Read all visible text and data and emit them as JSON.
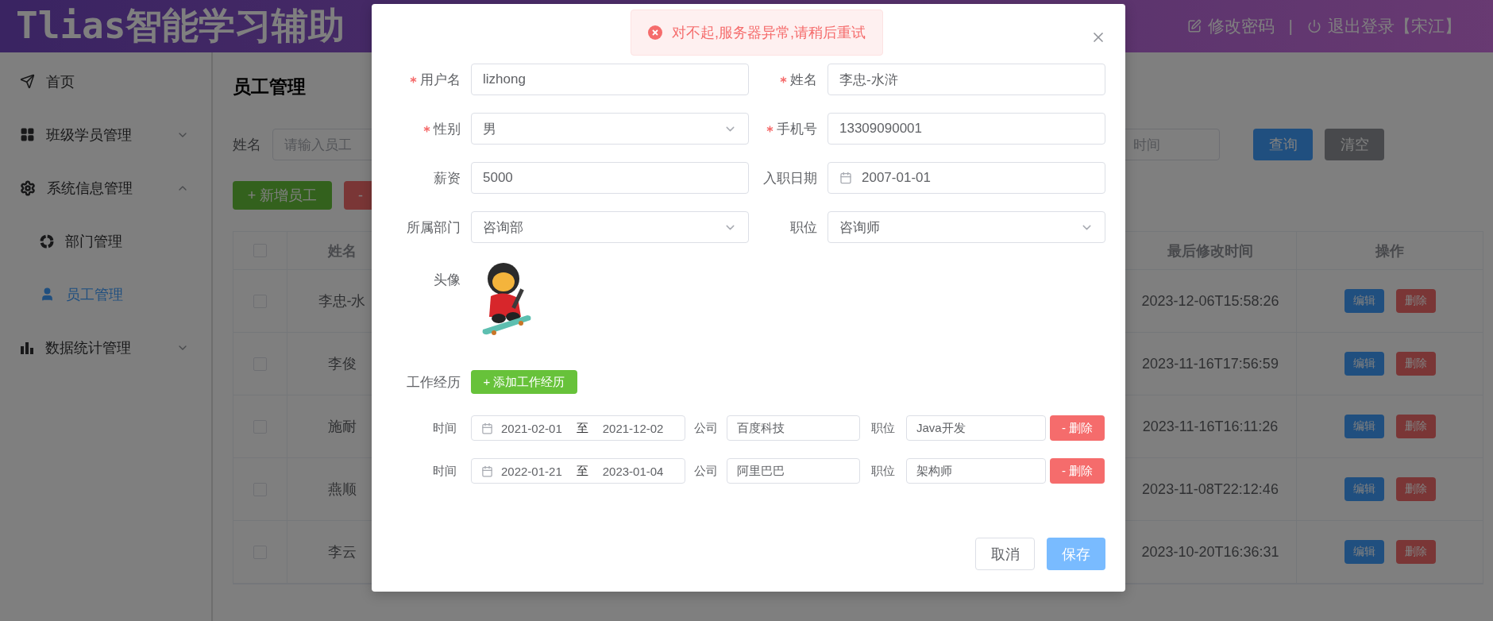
{
  "header": {
    "title": "Tlias智能学习辅助",
    "separator": "|",
    "actions": [
      {
        "label": "修改密码"
      },
      {
        "label": "退出登录【宋江】"
      }
    ]
  },
  "sidebar": {
    "items": [
      {
        "label": "首页",
        "selected": false
      },
      {
        "label": "班级学员管理",
        "selected": false,
        "expanded": false
      },
      {
        "label": "系统信息管理",
        "selected": false,
        "expanded": true,
        "children": [
          {
            "label": "部门管理",
            "selected": false
          },
          {
            "label": "员工管理",
            "selected": true
          }
        ]
      },
      {
        "label": "数据统计管理",
        "selected": false,
        "expanded": false
      }
    ]
  },
  "page": {
    "title": "员工管理",
    "search": {
      "name_label": "姓名",
      "name_placeholder": "请输入员工",
      "end_placeholder": "时间",
      "buttons": [
        {
          "label": "查询",
          "kind": "primary"
        },
        {
          "label": "清空",
          "kind": "info"
        }
      ]
    },
    "toolbar": [
      {
        "label": "+ 新增员工",
        "kind": "success"
      },
      {
        "label": "-",
        "kind": "danger"
      }
    ],
    "table": {
      "all_checked": false,
      "columns": [
        "姓名",
        "最后修改时间",
        "操作"
      ],
      "rows": [
        {
          "checked": false,
          "name": "李忠-水",
          "updated": "2023-12-06T15:58:26",
          "actions": [
            "编辑",
            "删除"
          ]
        },
        {
          "checked": false,
          "name": "李俊",
          "updated": "2023-11-16T17:56:59",
          "actions": [
            "编辑",
            "删除"
          ]
        },
        {
          "checked": false,
          "name": "施耐",
          "updated": "2023-11-16T16:11:26",
          "actions": [
            "编辑",
            "删除"
          ]
        },
        {
          "checked": false,
          "name": "燕顺",
          "updated": "2023-11-08T22:12:46",
          "actions": [
            "编辑",
            "删除"
          ]
        },
        {
          "checked": false,
          "name": "李云",
          "updated": "2023-10-20T16:36:31",
          "actions": [
            "编辑",
            "删除"
          ]
        }
      ]
    }
  },
  "dialog": {
    "message": {
      "kind": "error",
      "text": "对不起,服务器异常,请稍后重试"
    },
    "fields": [
      {
        "label": "用户名",
        "required": true,
        "kind": "text",
        "value": "lizhong"
      },
      {
        "label": "姓名",
        "required": true,
        "kind": "text",
        "value": "李忠-水浒"
      },
      {
        "label": "性别",
        "required": true,
        "kind": "select",
        "value": "男"
      },
      {
        "label": "手机号",
        "required": true,
        "kind": "text",
        "value": "13309090001"
      },
      {
        "label": "薪资",
        "required": false,
        "kind": "text",
        "value": "5000"
      },
      {
        "label": "入职日期",
        "required": false,
        "kind": "date",
        "value": "2007-01-01"
      },
      {
        "label": "所属部门",
        "required": false,
        "kind": "select",
        "value": "咨询部"
      },
      {
        "label": "职位",
        "required": false,
        "kind": "select",
        "value": "咨询师"
      }
    ],
    "avatar": {
      "label": "头像",
      "kind": "picture"
    },
    "experience": {
      "label": "工作经历",
      "add_button": "+ 添加工作经历",
      "rows": [
        {
          "time_label": "时间",
          "start": "2021-02-01",
          "separator": "至",
          "end": "2021-12-02",
          "company_label": "公司",
          "company": "百度科技",
          "position_label": "职位",
          "position": "Java开发",
          "delete_button": "- 删除"
        },
        {
          "time_label": "时间",
          "start": "2022-01-21",
          "separator": "至",
          "end": "2023-01-04",
          "company_label": "公司",
          "company": "阿里巴巴",
          "position_label": "职位",
          "position": "架构师",
          "delete_button": "- 删除"
        }
      ]
    },
    "footer": {
      "cancel": "取消",
      "save": "保存"
    }
  }
}
